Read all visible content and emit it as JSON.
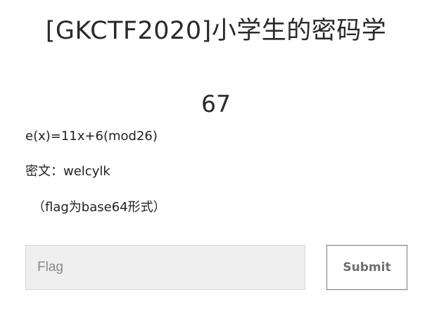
{
  "challenge": {
    "title": "[GKCTF2020]小学生的密码学",
    "points": "67",
    "description": [
      "e(x)=11x+6(mod26)",
      "密文：welcylk",
      "（flag为base64形式）"
    ]
  },
  "submission": {
    "flag_placeholder": "Flag",
    "flag_value": "",
    "submit_label": "Submit"
  },
  "colors": {
    "background": "#ffffff",
    "text": "#222222",
    "input_background": "#efefef",
    "input_border": "#d6d6d6",
    "button_border": "#777777",
    "button_text": "#6f6f6f"
  }
}
